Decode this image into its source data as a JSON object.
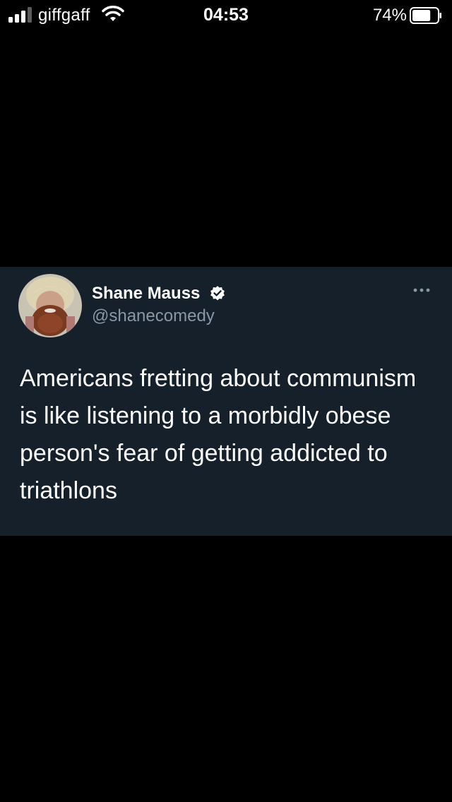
{
  "status_bar": {
    "carrier": "giffgaff",
    "time": "04:53",
    "battery_percent": "74%",
    "battery_level": 0.74,
    "signal_icon": "signal-bars-icon",
    "wifi_icon": "wifi-icon"
  },
  "tweet": {
    "display_name": "Shane Mauss",
    "handle": "@shanecomedy",
    "verified_icon": "verified-badge-icon",
    "more_icon": "more-options-icon",
    "text": "Americans fretting about communism is like listening to a morbidly obese person's fear of getting addicted to triathlons"
  },
  "colors": {
    "background": "#000000",
    "card_background": "#15202b",
    "handle_gray": "#8899a6",
    "verified_blue": "#ffffff"
  }
}
